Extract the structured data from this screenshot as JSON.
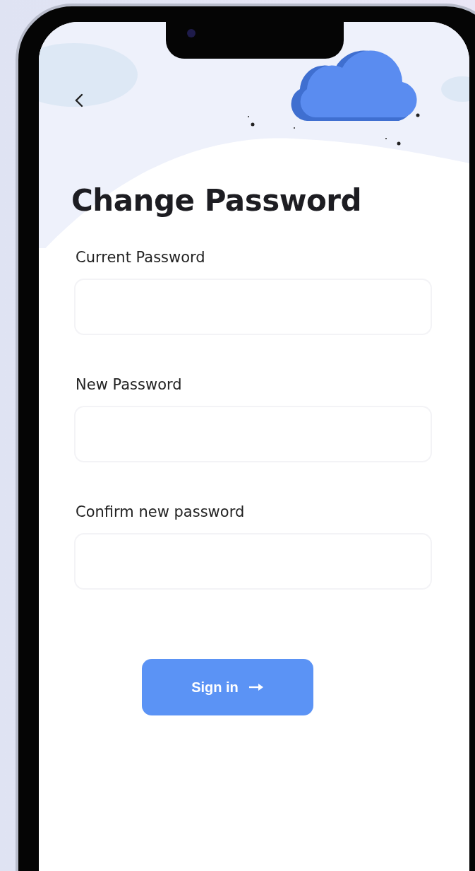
{
  "screen": {
    "title": "Change Password",
    "fields": [
      {
        "label": "Current Password"
      },
      {
        "label": "New Password"
      },
      {
        "label": "Confirm new password"
      }
    ],
    "button": {
      "label": "Sign in"
    }
  }
}
